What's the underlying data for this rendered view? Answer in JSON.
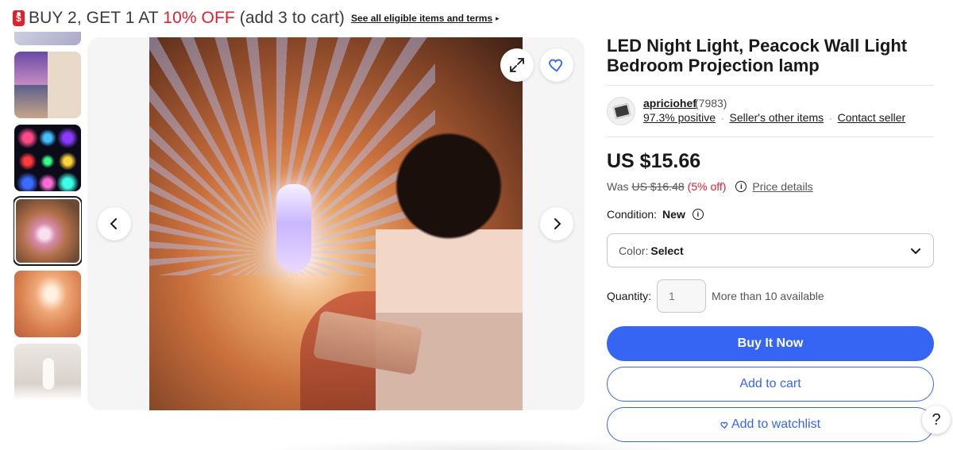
{
  "promo": {
    "headline_prefix": "BUY 2, GET 1 AT ",
    "headline_discount": "10% OFF",
    "headline_suffix": " (add 3 to cart)",
    "terms_link": "See all eligible items and terms",
    "tag_symbol": "$",
    "terms_arrow": "▸"
  },
  "gallery": {
    "thumbnail_count": 6,
    "selected_index": 3
  },
  "product": {
    "title": "LED Night Light, Peacock Wall Light Bedroom Projection lamp"
  },
  "seller": {
    "name": "apriciohef",
    "feedback_count": "(7983)",
    "positive": "97.3% positive",
    "other_items": "Seller's other items",
    "contact": "Contact seller",
    "separator": "·"
  },
  "price": {
    "current": "US $15.66",
    "was_label": "Was",
    "was_value": "US $16.48",
    "discount": "(5% off)",
    "details_link": "Price details"
  },
  "condition": {
    "label": "Condition:",
    "value": "New"
  },
  "variation": {
    "label": "Color:",
    "value": "Select"
  },
  "quantity": {
    "label": "Quantity:",
    "value": "1",
    "availability": "More than 10 available"
  },
  "actions": {
    "buy_now": "Buy It Now",
    "add_to_cart": "Add to cart",
    "add_to_watchlist": "Add to watchlist"
  },
  "help": {
    "label": "?"
  },
  "colors": {
    "accent": "#3665f3",
    "promo_red": "#e0202d",
    "text": "#191919"
  },
  "icons": [
    "sale-tag-icon",
    "expand-icon",
    "heart-icon",
    "chevron-left-icon",
    "chevron-right-icon",
    "info-icon",
    "chevron-down-icon",
    "help-icon"
  ]
}
